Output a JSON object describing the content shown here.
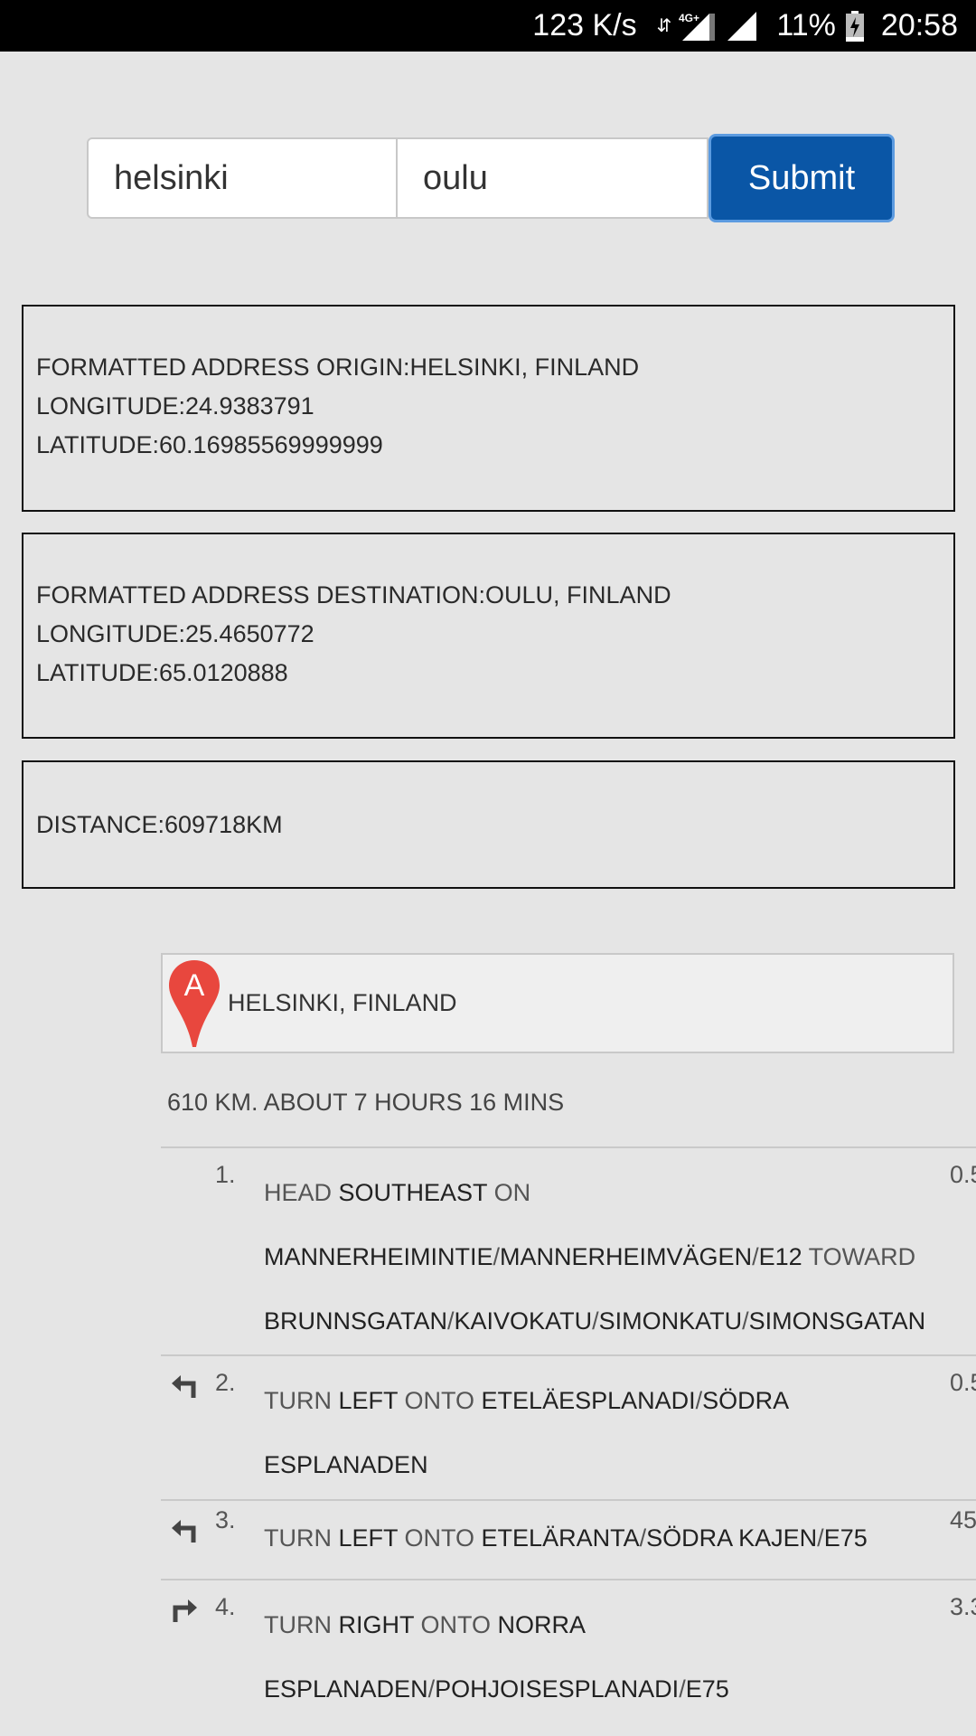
{
  "status_bar": {
    "speed": "123 K/s",
    "network_type": "4G+",
    "battery_percent": "11%",
    "time": "20:58"
  },
  "form": {
    "origin_value": "helsinki",
    "destination_value": "oulu",
    "submit_label": "Submit"
  },
  "origin_info": {
    "address": "FORMATTED ADDRESS ORIGIN:HELSINKI, FINLAND",
    "longitude": "LONGITUDE:24.9383791",
    "latitude": "LATITUDE:60.16985569999999"
  },
  "destination_info": {
    "address": "FORMATTED ADDRESS DESTINATION:OULU, FINLAND",
    "longitude": "LONGITUDE:25.4650772",
    "latitude": "LATITUDE:65.0120888"
  },
  "distance_info": {
    "distance": "DISTANCE:609718KM"
  },
  "directions": {
    "origin_marker": "A",
    "origin_address": "HELSINKI, FINLAND",
    "summary": "610 KM. ABOUT 7 HOURS 16 MINS",
    "steps": [
      {
        "number": "1.",
        "distance": "0.5",
        "icon": "none",
        "lines": [
          [
            {
              "t": "HEAD ",
              "b": false
            },
            {
              "t": "SOUTHEAST",
              "b": true
            },
            {
              "t": " ON",
              "b": false
            }
          ],
          [
            {
              "t": "MANNERHEIMINTIE",
              "b": true
            },
            {
              "t": "/",
              "b": false
            },
            {
              "t": "MANNERHEIMVÄGEN",
              "b": true
            },
            {
              "t": "/",
              "b": false
            },
            {
              "t": "E12",
              "b": true
            },
            {
              "t": " TOWARD",
              "b": false
            }
          ],
          [
            {
              "t": "BRUNNSGATAN",
              "b": true
            },
            {
              "t": "/",
              "b": false
            },
            {
              "t": "KAIVOKATU",
              "b": true
            },
            {
              "t": "/",
              "b": false
            },
            {
              "t": "SIMONKATU",
              "b": true
            },
            {
              "t": "/",
              "b": false
            },
            {
              "t": "SIMONSGATAN",
              "b": true
            }
          ]
        ]
      },
      {
        "number": "2.",
        "distance": "0.5",
        "icon": "turn-left-icon",
        "lines": [
          [
            {
              "t": "TURN ",
              "b": false
            },
            {
              "t": "LEFT",
              "b": true
            },
            {
              "t": " ONTO ",
              "b": false
            },
            {
              "t": "ETELÄESPLANADI",
              "b": true
            },
            {
              "t": "/",
              "b": false
            },
            {
              "t": "SÖDRA",
              "b": true
            }
          ],
          [
            {
              "t": "ESPLANADEN",
              "b": true
            }
          ]
        ]
      },
      {
        "number": "3.",
        "distance": "45",
        "icon": "turn-left-icon",
        "lines": [
          [
            {
              "t": "TURN ",
              "b": false
            },
            {
              "t": "LEFT",
              "b": true
            },
            {
              "t": " ONTO ",
              "b": false
            },
            {
              "t": "ETELÄRANTA",
              "b": true
            },
            {
              "t": "/",
              "b": false
            },
            {
              "t": "SÖDRA KAJEN",
              "b": true
            },
            {
              "t": "/",
              "b": false
            },
            {
              "t": "E75",
              "b": true
            }
          ]
        ]
      },
      {
        "number": "4.",
        "distance": "3.3",
        "icon": "turn-right-icon",
        "lines": [
          [
            {
              "t": "TURN ",
              "b": false
            },
            {
              "t": "RIGHT",
              "b": true
            },
            {
              "t": " ONTO ",
              "b": false
            },
            {
              "t": "NORRA",
              "b": true
            }
          ],
          [
            {
              "t": "ESPLANADEN",
              "b": true
            },
            {
              "t": "/",
              "b": false
            },
            {
              "t": "POHJOISESPLANADI",
              "b": true
            },
            {
              "t": "/",
              "b": false
            },
            {
              "t": "E75",
              "b": true
            }
          ]
        ]
      }
    ]
  },
  "colors": {
    "background": "#e5e5e5",
    "submit_bg": "#0a56a6",
    "marker_red": "#e8473e"
  }
}
